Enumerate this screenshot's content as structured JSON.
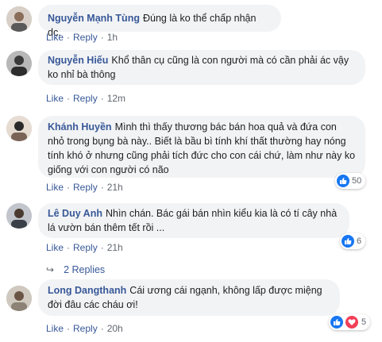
{
  "action_labels": {
    "like": "Like",
    "reply": "Reply",
    "dot": "·"
  },
  "comments": [
    {
      "author": "Nguyễn Mạnh Tùng",
      "text": "Đúng là ko thể chấp nhận dc.",
      "time": "1h"
    },
    {
      "author": "Nguyễn Hiếu",
      "text": "Khổ thân cụ cũng là con người mà có cần phải ác vậy ko nhỉ bà thông",
      "time": "12m"
    },
    {
      "author": "Khánh Huyền",
      "text": "Mình thì thấy thương bác bán hoa quả và đứa con nhỏ trong bụng bà này.. Biết là bầu bì tính khí thất thường hay nóng tính khó ở nhưng cũng phải tích đức cho con cái chứ, làm như này ko giống với con người có não",
      "time": "21h",
      "reactions": {
        "count": "50"
      }
    },
    {
      "author": "Lê Duy Anh",
      "text": "Nhìn chán. Bác gái bán nhìn kiểu kia là có tí cây nhà lá vườn bán thêm tết rồi ...",
      "time": "21h",
      "reactions": {
        "count": "6"
      }
    },
    {
      "author": "Long Dangthanh",
      "text": "Cái ương cái ngạnh, không lấp được miệng đời đâu các cháu ơi!",
      "time": "20h",
      "reactions": {
        "count": "5"
      }
    }
  ],
  "replies_label": "2 Replies",
  "colors": {
    "name": "#385898",
    "bubble": "#f2f3f5",
    "like": "#1877f2",
    "love": "#f33e58",
    "meta": "#606770"
  }
}
